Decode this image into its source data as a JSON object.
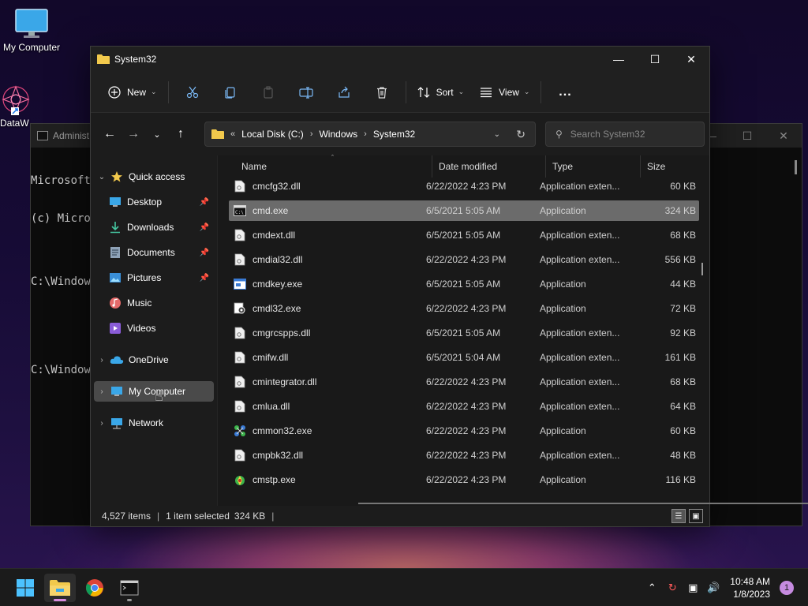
{
  "desktop": {
    "icons": [
      {
        "label": "My Computer"
      },
      {
        "label": "DataW"
      }
    ]
  },
  "cmd": {
    "title": "Administ",
    "lines": [
      "Microsoft",
      "(c) Micros",
      "",
      "C:\\Windows",
      "",
      "",
      "C:\\Windows"
    ]
  },
  "explorer": {
    "title": "System32",
    "toolbar": {
      "new_label": "New",
      "sort_label": "Sort",
      "view_label": "View",
      "more_label": "..."
    },
    "address": {
      "segments": [
        "Local Disk (C:)",
        "Windows",
        "System32"
      ]
    },
    "search": {
      "placeholder": "Search System32"
    },
    "nav": {
      "quick_access": "Quick access",
      "items": [
        {
          "label": "Desktop",
          "pinned": true
        },
        {
          "label": "Downloads",
          "pinned": true
        },
        {
          "label": "Documents",
          "pinned": true
        },
        {
          "label": "Pictures",
          "pinned": true
        },
        {
          "label": "Music",
          "pinned": false
        },
        {
          "label": "Videos",
          "pinned": false
        }
      ],
      "onedrive": "OneDrive",
      "mycomputer": "My Computer",
      "network": "Network"
    },
    "columns": {
      "name": "Name",
      "date": "Date modified",
      "type": "Type",
      "size": "Size"
    },
    "files": [
      {
        "name": "cmcfg32.dll",
        "date": "6/22/2022 4:23 PM",
        "type": "Application exten...",
        "size": "60 KB",
        "icon": "dll"
      },
      {
        "name": "cmd.exe",
        "date": "6/5/2021 5:05 AM",
        "type": "Application",
        "size": "324 KB",
        "icon": "cmd",
        "selected": true
      },
      {
        "name": "cmdext.dll",
        "date": "6/5/2021 5:05 AM",
        "type": "Application exten...",
        "size": "68 KB",
        "icon": "dll"
      },
      {
        "name": "cmdial32.dll",
        "date": "6/22/2022 4:23 PM",
        "type": "Application exten...",
        "size": "556 KB",
        "icon": "dll"
      },
      {
        "name": "cmdkey.exe",
        "date": "6/5/2021 5:05 AM",
        "type": "Application",
        "size": "44 KB",
        "icon": "exe"
      },
      {
        "name": "cmdl32.exe",
        "date": "6/22/2022 4:23 PM",
        "type": "Application",
        "size": "72 KB",
        "icon": "gear"
      },
      {
        "name": "cmgrcspps.dll",
        "date": "6/5/2021 5:05 AM",
        "type": "Application exten...",
        "size": "92 KB",
        "icon": "dll"
      },
      {
        "name": "cmifw.dll",
        "date": "6/5/2021 5:04 AM",
        "type": "Application exten...",
        "size": "161 KB",
        "icon": "dll"
      },
      {
        "name": "cmintegrator.dll",
        "date": "6/22/2022 4:23 PM",
        "type": "Application exten...",
        "size": "68 KB",
        "icon": "dll"
      },
      {
        "name": "cmlua.dll",
        "date": "6/22/2022 4:23 PM",
        "type": "Application exten...",
        "size": "64 KB",
        "icon": "dll"
      },
      {
        "name": "cmmon32.exe",
        "date": "6/22/2022 4:23 PM",
        "type": "Application",
        "size": "60 KB",
        "icon": "network"
      },
      {
        "name": "cmpbk32.dll",
        "date": "6/22/2022 4:23 PM",
        "type": "Application exten...",
        "size": "48 KB",
        "icon": "dll"
      },
      {
        "name": "cmstp.exe",
        "date": "6/22/2022 4:23 PM",
        "type": "Application",
        "size": "116 KB",
        "icon": "gear-green"
      }
    ],
    "status": {
      "items": "4,527 items",
      "selected": "1 item selected",
      "size": "324 KB"
    }
  },
  "taskbar": {
    "time": "10:48 AM",
    "date": "1/8/2023",
    "notifications": "1"
  },
  "colors": {
    "accent": "#c68be0",
    "folder": "#f2c94c",
    "selected_row": "#6b6b6b"
  }
}
